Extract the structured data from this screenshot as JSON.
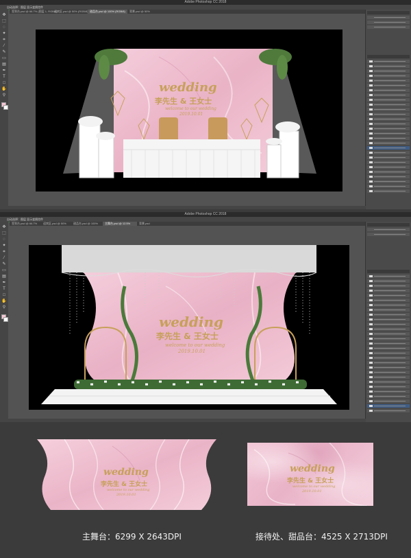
{
  "window": {
    "app_title": "Adobe Photoshop CC 2018",
    "options_text": "自动选择：图层  显示变换控件"
  },
  "window1": {
    "tabs": [
      {
        "label": "签到台.psd @ 66.7% (图层 1, RGB/8)"
      },
      {
        "label": "迎宾区.psd @ 50% (RGB/8)"
      },
      {
        "label": "甜品台.psd @ 100% (RGB/8)"
      },
      {
        "label": "背景.psd @ 50%"
      }
    ]
  },
  "window2": {
    "tabs": [
      {
        "label": "签到台.psd @ 66.7%"
      },
      {
        "label": "迎宾区.psd @ 50%"
      },
      {
        "label": "甜品台.psd @ 100%"
      },
      {
        "label": "主舞台.psd @ 12.5%"
      },
      {
        "label": "背景.psd"
      }
    ]
  },
  "design": {
    "wedding": "wedding",
    "names": "李先生 & 王女士",
    "welcome": "welcome to our wedding",
    "date": "2019.10.01"
  },
  "captions": {
    "main_stage": "主舞台：6299 X 2643DPI",
    "reception": "接待处、甜品台：4525 X 2713DPI"
  },
  "colors": {
    "gold": "#c7a05a",
    "pink": "#efbfd0",
    "ps_gray": "#535353",
    "page_bg": "#3b3b3b"
  }
}
